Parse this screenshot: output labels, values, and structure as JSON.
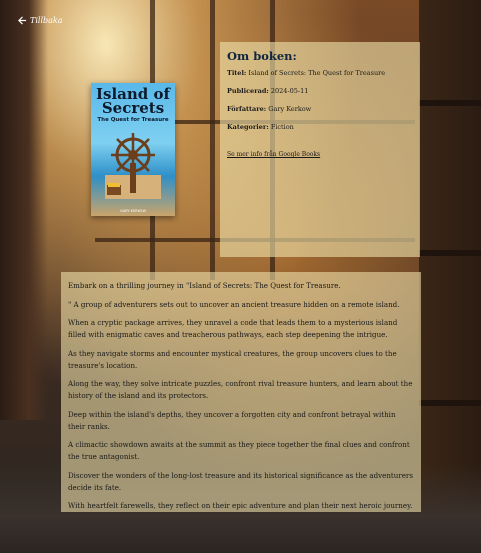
{
  "nav": {
    "back_label": "Tillbaka"
  },
  "book": {
    "cover": {
      "title_line1": "Island of",
      "title_line2": "Secrets",
      "subtitle": "The Quest for Treasure",
      "author": "GARY KERKOW"
    }
  },
  "about": {
    "heading": "Om boken:",
    "title_label": "Titel:",
    "title_value": "Island of Secrets: The Quest for Treasure",
    "published_label": "Publicerad:",
    "published_value": "2024-05-11",
    "author_label": "Författare:",
    "author_value": "Gary Kerkow",
    "categories_label": "Kategorier:",
    "categories_value": "Fiction",
    "more_info_link": "Se mer info från Google Books"
  },
  "description": {
    "paragraphs": [
      "Embark on a thrilling journey in \"Island of Secrets: The Quest for Treasure.",
      "\" A group of adventurers sets out to uncover an ancient treasure hidden on a remote island.",
      "When a cryptic package arrives, they unravel a code that leads them to a mysterious island filled with enigmatic caves and treacherous pathways, each step deepening the intrigue.",
      "As they navigate storms and encounter mystical creatures, the group uncovers clues to the treasure's location.",
      "Along the way, they solve intricate puzzles, confront rival treasure hunters, and learn about the history of the island and its protectors.",
      "Deep within the island's depths, they uncover a forgotten city and confront betrayal within their ranks.",
      "A climactic showdown awaits at the summit as they piece together the final clues and confront the true antagonist.",
      "Discover the wonders of the long-lost treasure and its historical significance as the adventurers decide its fate.",
      "With heartfelt farewells, they reflect on their epic adventure and plan their next heroic journey."
    ]
  },
  "colors": {
    "panel": "#EEE0AA",
    "heading": "#0F2540",
    "cover_sky": "#59B8EA"
  }
}
